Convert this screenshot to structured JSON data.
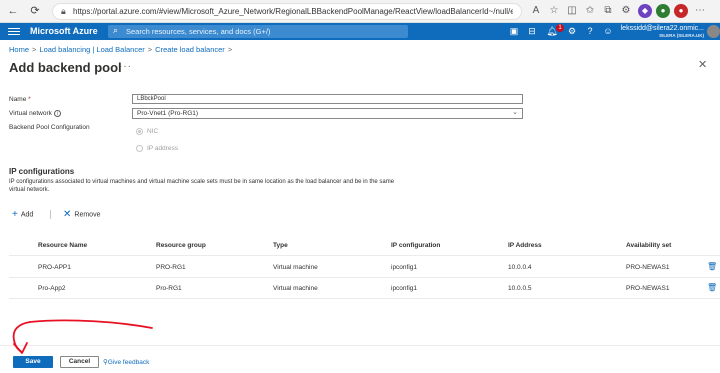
{
  "browser": {
    "url": "https://portal.azure.com/#view/Microsoft_Azure_Network/RegionalLBBackendPoolManage/ReactView/loadBalancerId~/null/expan...",
    "reader_label": "A"
  },
  "header": {
    "brand": "Microsoft Azure",
    "search_placeholder": "Search resources, services, and docs (G+/)",
    "notification_count": "1",
    "account_name": "lekssidd@silera22.onmic...",
    "account_tenant": "SILERA (SILERA.UK)"
  },
  "breadcrumb": [
    "Home",
    "Load balancing | Load Balancer",
    "Create load balancer"
  ],
  "page": {
    "title": "Add backend pool",
    "more": "···",
    "close": "✕"
  },
  "form": {
    "name_label": "Name",
    "name_required": "*",
    "name_value": "LBbckPool",
    "vnet_label": "Virtual network",
    "vnet_value": "Pro-Vnet1 (Pro-RG1)",
    "config_label": "Backend Pool Configuration",
    "radio_nic": "NIC",
    "radio_ip": "IP address"
  },
  "ip_config": {
    "title": "IP configurations",
    "description": "IP configurations associated to virtual machines and virtual machine scale sets must be in same location as the load balancer and be in the same virtual network.",
    "add_label": "Add",
    "remove_label": "Remove"
  },
  "table": {
    "columns": [
      "Resource Name",
      "Resource group",
      "Type",
      "IP configuration",
      "IP Address",
      "Availability set"
    ],
    "rows": [
      [
        "PRO-APP1",
        "PRO-RG1",
        "Virtual machine",
        "ipconfig1",
        "10.0.0.4",
        "PRO-NEWAS1"
      ],
      [
        "Pro-App2",
        "Pro-RG1",
        "Virtual machine",
        "ipconfig1",
        "10.0.0.5",
        "PRO-NEWAS1"
      ]
    ]
  },
  "footer": {
    "save_label": "Save",
    "cancel_label": "Cancel",
    "feedback_label": "Give feedback"
  },
  "colors": {
    "azure_blue": "#0f6cbd",
    "annotation_red": "#e81123"
  },
  "icons": [
    "back-arrow-icon",
    "refresh-icon",
    "lock-icon",
    "star-icon",
    "hamburger-icon",
    "search-icon",
    "cloud-shell-icon",
    "notifications-icon",
    "settings-icon",
    "help-icon",
    "feedback-icon",
    "info-icon",
    "chevron-down-icon",
    "plus-icon",
    "x-icon",
    "trash-icon",
    "close-icon"
  ]
}
